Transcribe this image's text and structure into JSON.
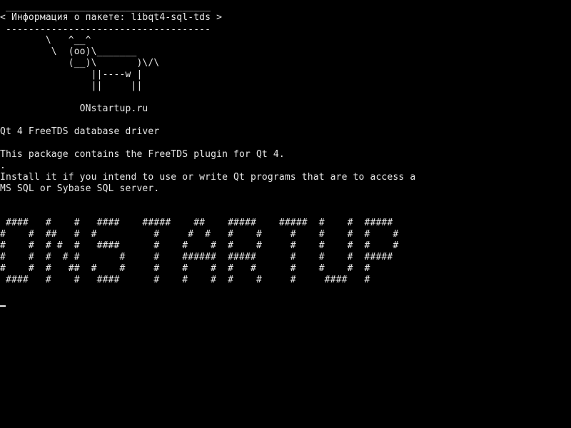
{
  "terminal": {
    "lines": [
      {
        "text": " ____________________________________"
      },
      {
        "text": "< Информация о пакете: libqt4-sql-tds >"
      },
      {
        "text": " ------------------------------------"
      },
      {
        "text": "        \\   ^__^"
      },
      {
        "text": "         \\  (oo)\\_______"
      },
      {
        "text": "            (__)\\       )\\/\\"
      },
      {
        "text": "                ||----w |"
      },
      {
        "text": "                ||     ||"
      },
      {
        "text": ""
      },
      {
        "text": "              ONstartup.ru"
      },
      {
        "text": ""
      },
      {
        "text": "Qt 4 FreeTDS database driver"
      },
      {
        "text": ""
      },
      {
        "text": "This package contains the FreeTDS plugin for Qt 4."
      },
      {
        "text": "."
      },
      {
        "text": "Install it if you intend to use or write Qt programs that are to access a"
      },
      {
        "text": "MS SQL or Sybase SQL server."
      },
      {
        "text": ""
      },
      {
        "text": ""
      },
      {
        "text": " ####   #    #   ####    #####    ##    #####    #####  #    #  #####"
      },
      {
        "text": "#    #  ##   #  #          #     #  #   #    #     #    #    #  #    #"
      },
      {
        "text": "#    #  # #  #   ####      #    #    #  #    #     #    #    #  #    #"
      },
      {
        "text": "#    #  #  # #       #     #    ######  #####      #    #    #  #####"
      },
      {
        "text": "#    #  #   ##  #    #     #    #    #  #   #      #    #    #  #"
      },
      {
        "text": " ####   #    #   ####      #    #    #  #    #     #     ####   #"
      }
    ]
  }
}
